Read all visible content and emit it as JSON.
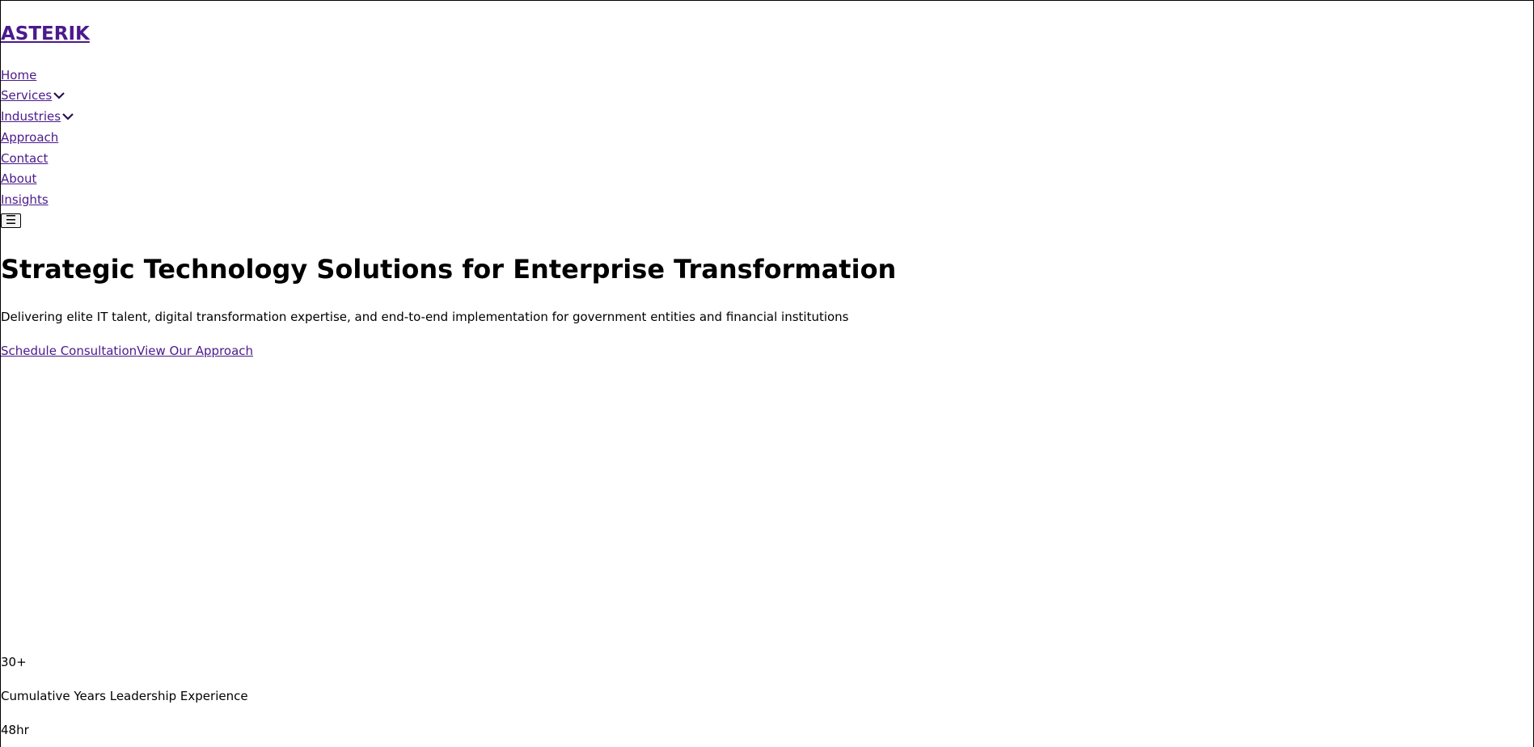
{
  "brand": {
    "logo": "ASTERIK"
  },
  "nav": {
    "items": [
      {
        "label": "Home",
        "has_dropdown": false
      },
      {
        "label": "Services",
        "has_dropdown": true
      },
      {
        "label": "Industries",
        "has_dropdown": true
      },
      {
        "label": "Approach",
        "has_dropdown": false
      },
      {
        "label": "Contact",
        "has_dropdown": false
      },
      {
        "label": "About",
        "has_dropdown": false
      },
      {
        "label": "Insights",
        "has_dropdown": false
      }
    ],
    "menu_toggle_icon": "hamburger-icon",
    "dropdown_icon": "chevron-down-icon"
  },
  "hero": {
    "title": "Strategic Technology Solutions for Enterprise Transformation",
    "subtitle": "Delivering elite IT talent, digital transformation expertise, and end-to-end implementation for government entities and financial institutions",
    "cta_primary": "Schedule Consultation",
    "cta_secondary": "View Our Approach"
  },
  "stats": [
    {
      "value": "30+",
      "label": "Cumulative Years Leadership Experience"
    },
    {
      "value": "48hr"
    }
  ],
  "colors": {
    "link": "#4b1a8c",
    "text": "#000000",
    "background": "#ffffff"
  }
}
